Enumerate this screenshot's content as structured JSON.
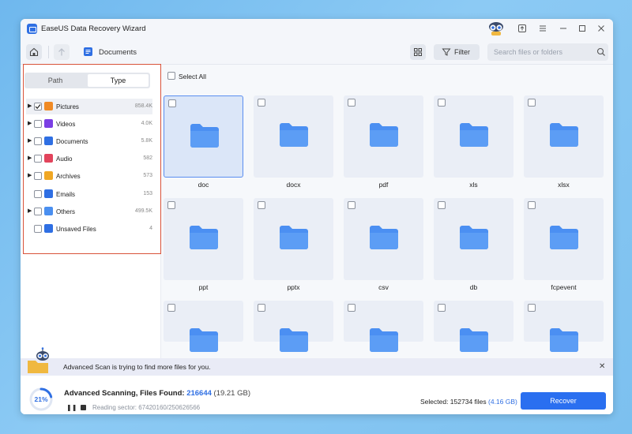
{
  "window": {
    "title": "EaseUS Data Recovery Wizard",
    "controls": [
      "minimize",
      "maximize",
      "close"
    ]
  },
  "toolbar": {
    "breadcrumb": "Documents",
    "filter_label": "Filter",
    "search_placeholder": "Search files or folders"
  },
  "sidebar": {
    "tabs": {
      "path": "Path",
      "type": "Type",
      "active": "Type"
    },
    "items": [
      {
        "label": "Pictures",
        "count": "858.4K",
        "checked": true,
        "expandable": true,
        "icon": "pictures-icon",
        "color": "#f08a24"
      },
      {
        "label": "Videos",
        "count": "4.0K",
        "checked": false,
        "expandable": true,
        "icon": "videos-icon",
        "color": "#7b3fe4"
      },
      {
        "label": "Documents",
        "count": "5.8K",
        "checked": false,
        "expandable": true,
        "icon": "documents-icon",
        "color": "#2f6fe3"
      },
      {
        "label": "Audio",
        "count": "582",
        "checked": false,
        "expandable": true,
        "icon": "audio-icon",
        "color": "#e2445c"
      },
      {
        "label": "Archives",
        "count": "573",
        "checked": false,
        "expandable": true,
        "icon": "archives-icon",
        "color": "#f0a724"
      },
      {
        "label": "Emails",
        "count": "153",
        "checked": false,
        "expandable": false,
        "icon": "emails-icon",
        "color": "#2f6fe3"
      },
      {
        "label": "Others",
        "count": "499.5K",
        "checked": false,
        "expandable": true,
        "icon": "others-icon",
        "color": "#4a8ff0"
      },
      {
        "label": "Unsaved Files",
        "count": "4",
        "checked": false,
        "expandable": false,
        "icon": "unsaved-files-icon",
        "color": "#2f6fe3"
      }
    ]
  },
  "main": {
    "select_all_label": "Select All",
    "folders": [
      "doc",
      "docx",
      "pdf",
      "xls",
      "xlsx",
      "ppt",
      "pptx",
      "csv",
      "db",
      "fcpevent",
      "",
      "",
      "",
      "",
      ""
    ],
    "selected_folder": "doc"
  },
  "notification": {
    "text": "Advanced Scan is trying to find more files for you."
  },
  "status": {
    "progress": "21%",
    "progress_value": 0.21,
    "scan_title": "Advanced Scanning, Files Found: ",
    "files_found": "216644",
    "size": " (19.21 GB)",
    "sector_label": "Reading sector: 67420160/250626566",
    "selected_prefix": "Selected: 152734 files ",
    "selected_size": "(4.16 GB)",
    "recover_label": "Recover"
  },
  "colors": {
    "accent": "#2a6ff0",
    "highlight_frame": "#d9533a",
    "folder_blue": "#4b8ff2"
  }
}
